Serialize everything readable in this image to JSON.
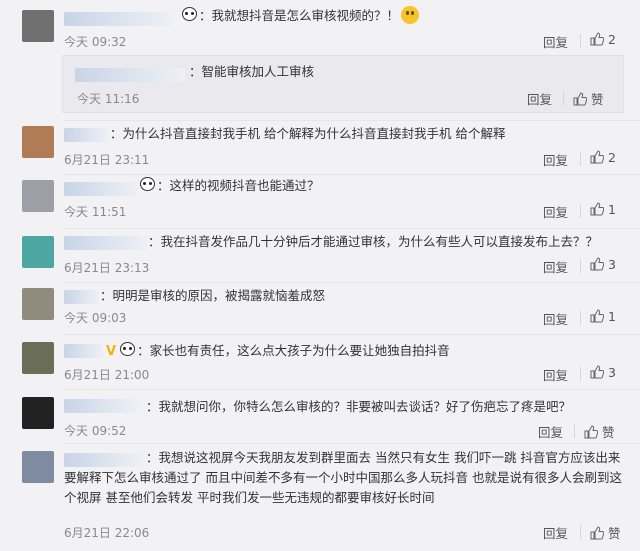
{
  "comments": [
    {
      "text": "：我就想抖音是怎么审核视频的？！",
      "time": "今天 09:32",
      "reply": "回复",
      "likes": "2",
      "decor": "panda-face"
    },
    {
      "text": "：智能审核加人工审核",
      "time": "今天 11:16",
      "reply": "回复",
      "likes": "赞"
    },
    {
      "text": "：为什么抖音直接封我手机 给个解释为什么抖音直接封我手机 给个解释",
      "time": "6月21日 23:11",
      "reply": "回复",
      "likes": "2"
    },
    {
      "text": "：这样的视频抖音也能通过？",
      "time": "今天 11:51",
      "reply": "回复",
      "likes": "1"
    },
    {
      "text": "：我在抖音发作品几十分钟后才能通过审核，为什么有些人可以直接发布上去？？",
      "time": "6月21日 23:13",
      "reply": "回复",
      "likes": "3"
    },
    {
      "text": "：明明是审核的原因，被揭露就恼羞成怒",
      "time": "今天 09:03",
      "reply": "回复",
      "likes": "1"
    },
    {
      "text": "：家长也有责任，这么点大孩子为什么要让她独自拍抖音",
      "time": "6月21日 21:00",
      "reply": "回复",
      "likes": "3"
    },
    {
      "text": "：我就想问你，你特么怎么审核的？非要被叫去谈话？好了伤疤忘了疼是吧？",
      "time": "今天 09:52",
      "reply": "回复",
      "likes": "赞"
    },
    {
      "text": "：我想说这视屏今天我朋友发到群里面去  当然只有女生   我们吓一跳   抖音官方应该出来要解释下怎么审核通过了     而且中间差不多有一个小时中国那么多人玩抖音  也就是说有很多人会刷到这个视屏   甚至他们会转发   平时我们发一些无违规的都要审核好长时间",
      "time": "6月21日 22:06",
      "reply": "回复",
      "likes": "赞"
    }
  ],
  "colors": {
    "avatar0": "#6f6f6f",
    "avatar2": "#b0805a",
    "avatar3": "#9aa0a6",
    "avatar4": "#4ea5a0",
    "avatar5": "#8e8a7c",
    "avatar6": "#6a6e58",
    "avatar7": "#222222",
    "avatar8": "#7e8aa0"
  }
}
